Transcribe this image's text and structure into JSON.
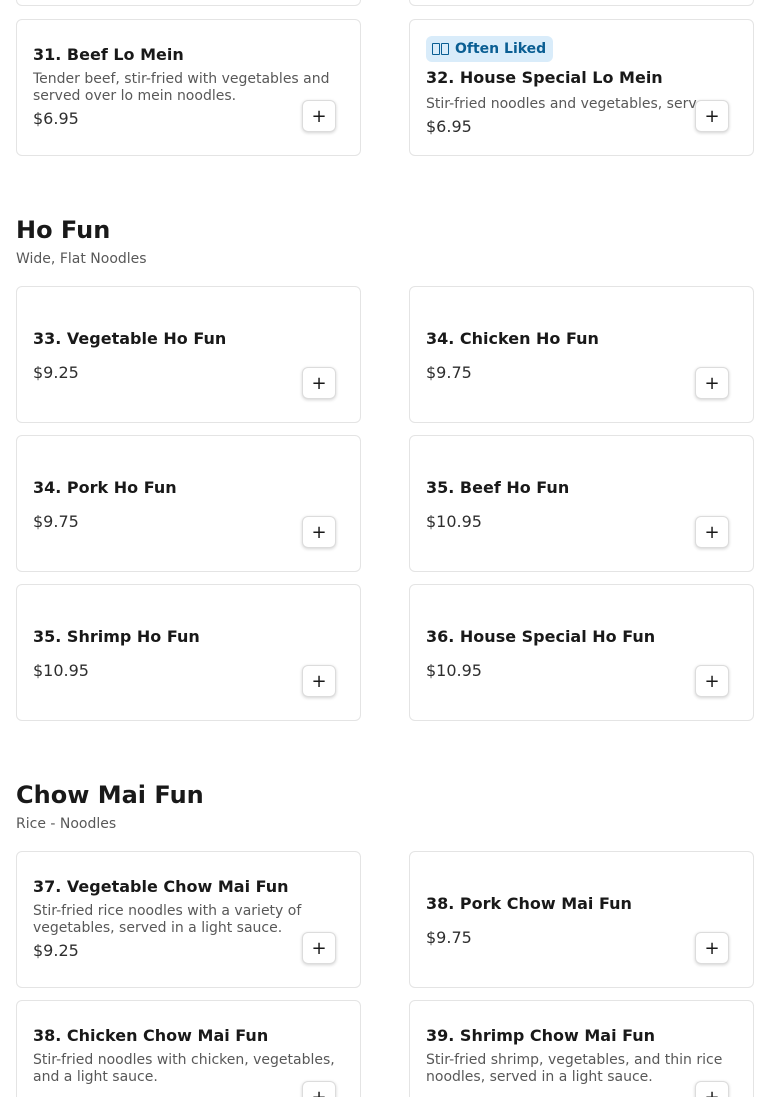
{
  "sections": [
    {
      "items": [
        {
          "title": "31. Beef Lo Mein",
          "desc": "Tender beef, stir-fried with vegetables and served over lo mein noodles.",
          "price": "$6.95",
          "add_label": "+"
        },
        {
          "badge": "Often Liked",
          "badge_icon": "thumbs-up-icon",
          "title": "32. House Special Lo Mein",
          "desc": "Stir-fried noodles and vegetables, serv...",
          "price": "$6.95",
          "add_label": "+"
        }
      ]
    },
    {
      "title": "Ho Fun",
      "subtitle": "Wide, Flat Noodles",
      "items": [
        {
          "title": "33. Vegetable Ho Fun",
          "price": "$9.25",
          "add_label": "+"
        },
        {
          "title": "34. Chicken Ho Fun",
          "price": "$9.75",
          "add_label": "+"
        },
        {
          "title": "34. Pork Ho Fun",
          "price": "$9.75",
          "add_label": "+"
        },
        {
          "title": "35. Beef Ho Fun",
          "price": "$10.95",
          "add_label": "+"
        },
        {
          "title": "35. Shrimp Ho Fun",
          "price": "$10.95",
          "add_label": "+"
        },
        {
          "title": "36. House Special Ho Fun",
          "price": "$10.95",
          "add_label": "+"
        }
      ]
    },
    {
      "title": "Chow Mai Fun",
      "subtitle": "Rice - Noodles",
      "items": [
        {
          "title": "37. Vegetable Chow Mai Fun",
          "desc": "Stir-fried rice noodles with a variety of vegetables, served in a light sauce.",
          "price": "$9.25",
          "add_label": "+"
        },
        {
          "title": "38. Pork Chow Mai Fun",
          "price": "$9.75",
          "add_label": "+"
        },
        {
          "title": "38. Chicken Chow Mai Fun",
          "desc": "Stir-fried noodles with chicken, vegetables, and a light sauce.",
          "price": "",
          "add_label": "+"
        },
        {
          "title": "39. Shrimp Chow Mai Fun",
          "desc": "Stir-fried shrimp, vegetables, and thin rice noodles, served in a light sauce.",
          "price": "",
          "add_label": "+"
        }
      ]
    }
  ],
  "colors": {
    "badge_bg": "#d9ecfa",
    "badge_text": "#0a5e93",
    "border": "#e4e4e4"
  }
}
